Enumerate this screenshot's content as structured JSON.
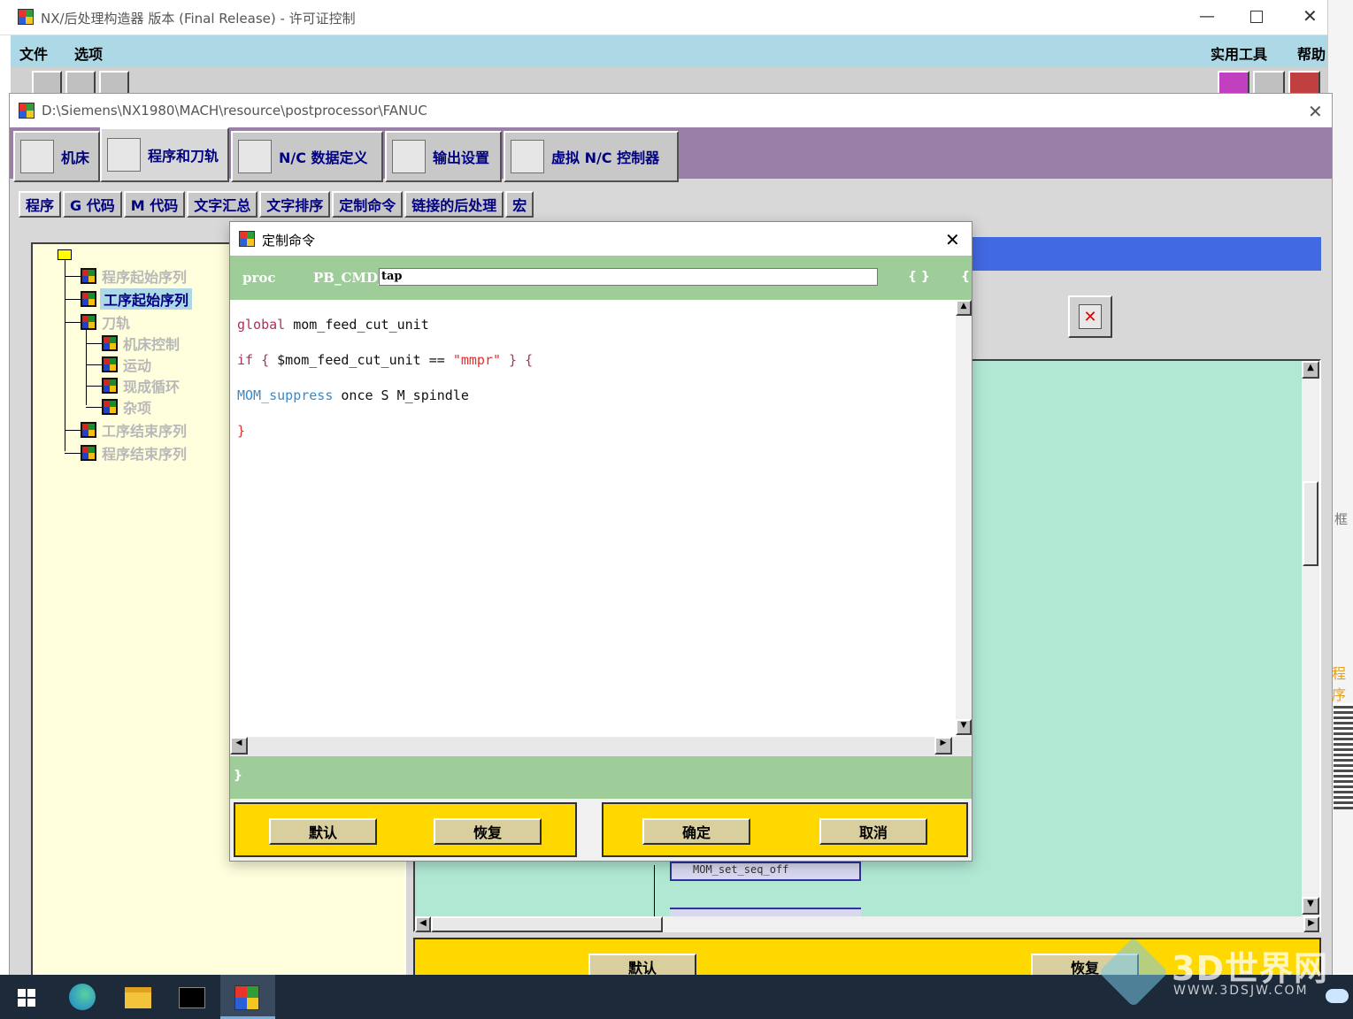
{
  "main_window": {
    "title": "NX/后处理构造器 版本 (Final Release) - 许可证控制",
    "menu": {
      "file": "文件",
      "options": "选项",
      "utilities": "实用工具",
      "help": "帮助"
    }
  },
  "child_window": {
    "path": "D:\\Siemens\\NX1980\\MACH\\resource\\postprocessor\\FANUC",
    "main_tabs": [
      "机床",
      "程序和刀轨",
      "N/C 数据定义",
      "输出设置",
      "虚拟 N/C 控制器"
    ],
    "sub_tabs": [
      "程序",
      "G 代码",
      "M 代码",
      "文字汇总",
      "文字排序",
      "定制命令",
      "链接的后处理",
      "宏"
    ],
    "tree": {
      "items": [
        "程序起始序列",
        "工序起始序列",
        "刀轨",
        "机床控制",
        "运动",
        "现成循环",
        "杂项",
        "工序结束序列",
        "程序结束序列"
      ],
      "selected_index": 1
    },
    "behind_event": "MOM_set_seq_off",
    "bottom_buttons": {
      "default": "默认",
      "restore": "恢复"
    }
  },
  "dialog": {
    "title": "定制命令",
    "proc_keyword": "proc",
    "prefix": "PB_CMD_",
    "command_name": "tap",
    "braces": "{ }",
    "brace_open": "{",
    "code_lines": [
      [
        {
          "t": "global",
          "c": "kw"
        },
        {
          "t": " mom_feed_cut_unit",
          "c": "plain"
        }
      ],
      [
        {
          "t": "if { ",
          "c": "kw"
        },
        {
          "t": "$mom_feed_cut_unit == ",
          "c": "plain"
        },
        {
          "t": "\"mmpr\"",
          "c": "str"
        },
        {
          "t": " } {",
          "c": "kw"
        }
      ],
      [
        {
          "t": "MOM_suppress",
          "c": "fn"
        },
        {
          "t": " once S M_spindle",
          "c": "plain"
        }
      ],
      [
        {
          "t": "}",
          "c": "str"
        }
      ]
    ],
    "closing_brace": "}",
    "buttons": {
      "default": "默认",
      "restore": "恢复",
      "ok": "确定",
      "cancel": "取消"
    }
  },
  "watermark": {
    "brand": "3D世界网",
    "url": "WWW.3DSJW.COM"
  },
  "right_edge_fragments": [
    "框",
    "程序"
  ],
  "colors": {
    "menu_bar": "#add8e6",
    "purple_tabbar": "#9a7fa8",
    "tree_bg": "#ffffdd",
    "teal_area": "#b0e8d4",
    "dialog_green": "#9ecd9a",
    "yellow_panel": "#ffd800",
    "blue_header": "#4169e1",
    "taskbar": "#1c2a3a"
  }
}
